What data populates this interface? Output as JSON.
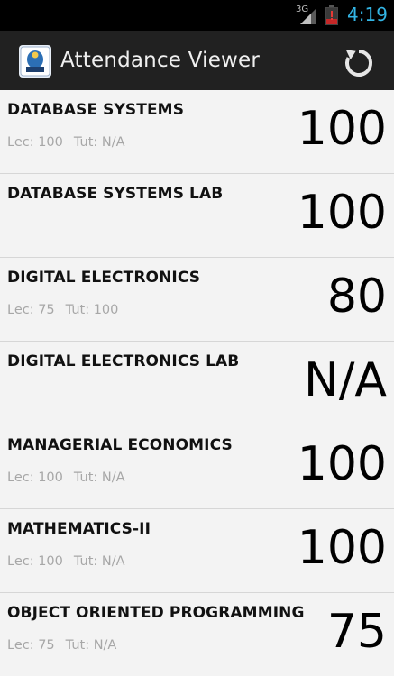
{
  "status_bar": {
    "network": "3G",
    "time": "4:19",
    "time_color": "#33b5e5"
  },
  "action_bar": {
    "title": "Attendance Viewer",
    "app_icon": "jiit-logo",
    "refresh_icon": "refresh-icon"
  },
  "subjects": [
    {
      "name": "DATABASE SYSTEMS",
      "lec": "Lec: 100",
      "tut": "Tut: N/A",
      "percent": "100"
    },
    {
      "name": "DATABASE SYSTEMS LAB",
      "lec": "",
      "tut": "",
      "percent": "100"
    },
    {
      "name": "DIGITAL ELECTRONICS",
      "lec": "Lec: 75",
      "tut": "Tut: 100",
      "percent": "80"
    },
    {
      "name": "DIGITAL ELECTRONICS LAB",
      "lec": "",
      "tut": "",
      "percent": "N/A"
    },
    {
      "name": "MANAGERIAL ECONOMICS",
      "lec": "Lec: 100",
      "tut": "Tut: N/A",
      "percent": "100"
    },
    {
      "name": "MATHEMATICS-II",
      "lec": "Lec: 100",
      "tut": "Tut: N/A",
      "percent": "100"
    },
    {
      "name": "OBJECT ORIENTED PROGRAMMING",
      "lec": "Lec: 75",
      "tut": "Tut: N/A",
      "percent": "75"
    }
  ]
}
